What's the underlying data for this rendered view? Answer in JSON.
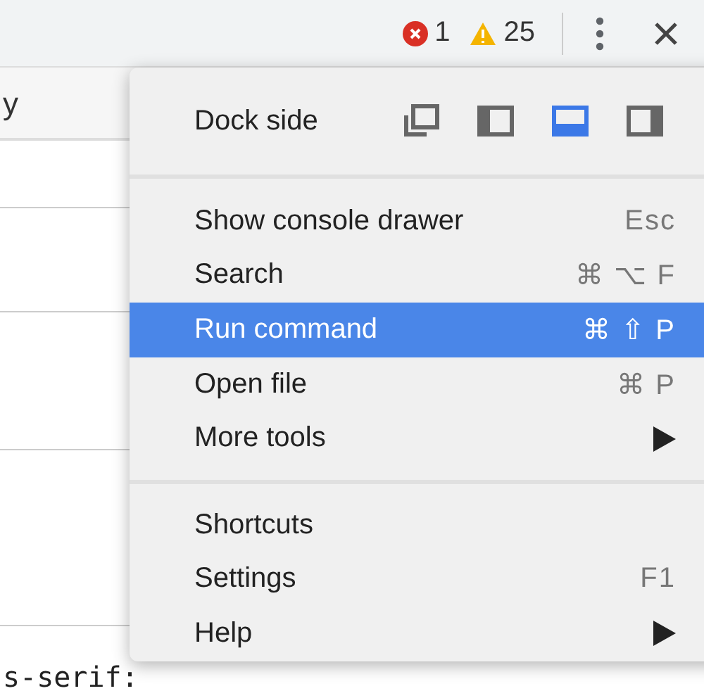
{
  "toolbar": {
    "errors": "1",
    "warnings": "25"
  },
  "panel": {
    "header_text": "y",
    "code_text": "s-serif:"
  },
  "menu": {
    "dock_side": {
      "label": "Dock side",
      "options": [
        {
          "kind": "undock",
          "selected": false
        },
        {
          "kind": "left",
          "selected": false
        },
        {
          "kind": "bottom",
          "selected": true
        },
        {
          "kind": "right",
          "selected": false
        }
      ]
    },
    "sections": [
      {
        "items": [
          {
            "label": "Show console drawer",
            "shortcut": "Esc",
            "submenu": false,
            "highlighted": false
          },
          {
            "label": "Search",
            "shortcut": "⌘ ⌥ F",
            "submenu": false,
            "highlighted": false
          },
          {
            "label": "Run command",
            "shortcut": "⌘ ⇧ P",
            "submenu": false,
            "highlighted": true
          },
          {
            "label": "Open file",
            "shortcut": "⌘ P",
            "submenu": false,
            "highlighted": false
          },
          {
            "label": "More tools",
            "submenu": true,
            "highlighted": false
          }
        ]
      },
      {
        "items": [
          {
            "label": "Shortcuts",
            "submenu": false,
            "highlighted": false
          },
          {
            "label": "Settings",
            "shortcut": "F1",
            "submenu": false,
            "highlighted": false
          },
          {
            "label": "Help",
            "submenu": true,
            "highlighted": false
          }
        ]
      }
    ]
  }
}
